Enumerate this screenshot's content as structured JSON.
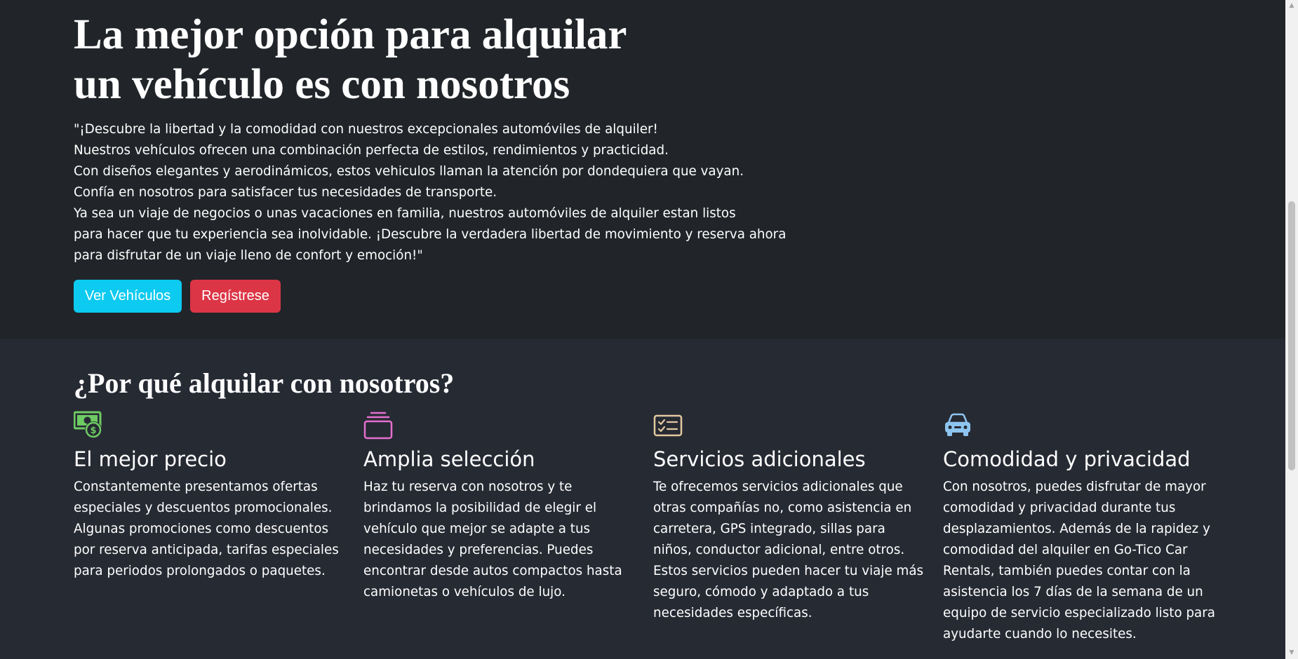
{
  "hero": {
    "title_lines": [
      "La mejor opción para alquilar",
      "un vehículo es con nosotros"
    ],
    "description_lines": [
      "\"¡Descubre la libertad y la comodidad con nuestros excepcionales automóviles de alquiler!",
      "Nuestros vehículos ofrecen una combinación perfecta de estilos, rendimientos y practicidad.",
      "Con diseños elegantes y aerodinámicos, estos vehiculos llaman la atención por dondequiera que vayan.",
      "Confía en nosotros para satisfacer tus necesidades de transporte.",
      "Ya sea un viaje de negocios o unas vacaciones en familia, nuestros automóviles de alquiler estan listos",
      "para hacer que tu experiencia sea inolvidable. ¡Descubre la verdadera libertad de movimiento y reserva ahora",
      "para disfrutar de un viaje lleno de confort y emoción!\""
    ],
    "buttons": {
      "vehicles_label": "Ver Vehículos",
      "register_label": "Regístrese"
    },
    "colors": {
      "background": "#212529",
      "info_button": "#0dcaf0",
      "danger_button": "#dc3545"
    }
  },
  "features": {
    "heading": "¿Por qué alquilar con nosotros?",
    "items": [
      {
        "icon": "cash-coin-icon",
        "icon_color": "#6ecb63",
        "title": "El mejor precio",
        "text": "Constantemente presentamos ofertas especiales y descuentos promocionales. Algunas promociones como descuentos por reserva anticipada, tarifas especiales para periodos prolongados o paquetes."
      },
      {
        "icon": "collection-icon",
        "icon_color": "#e56fcf",
        "title": "Amplia selección",
        "text": "Haz tu reserva con nosotros y te brindamos la posibilidad de elegir el vehículo que mejor se adapte a tus necesidades y preferencias. Puedes encontrar desde autos compactos hasta camionetas o vehículos de lujo."
      },
      {
        "icon": "card-checklist-icon",
        "icon_color": "#e3c9a0",
        "title": "Servicios adicionales",
        "text": "Te ofrecemos servicios adicionales que otras compañías no, como asistencia en carretera, GPS integrado, sillas para niños, conductor adicional, entre otros. Estos servicios pueden hacer tu viaje más seguro, cómodo y adaptado a tus necesidades específicas."
      },
      {
        "icon": "car-front-icon",
        "icon_color": "#8ec5f0",
        "title": "Comodidad y privacidad",
        "text": "Con nosotros, puedes disfrutar de mayor comodidad y privacidad durante tus desplazamientos. Además de la rapidez y comodidad del alquiler en Go-Tico Car Rentals, también puedes contar con la asistencia los 7 días de la semana de un equipo de servicio especializado listo para ayudarte cuando lo necesites."
      }
    ]
  }
}
